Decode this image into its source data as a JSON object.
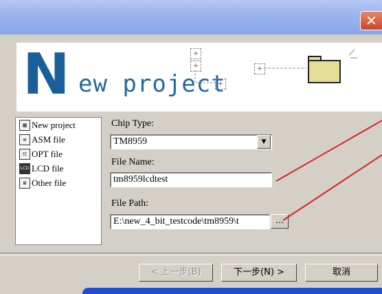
{
  "window": {
    "close_glyph": "✕"
  },
  "banner": {
    "big_letter": "N",
    "title_rest": "ew project",
    "deco_plus": "+"
  },
  "sidebar": {
    "items": [
      {
        "label": "New project",
        "icon": "new-project-icon"
      },
      {
        "label": "ASM file",
        "icon": "asm-file-icon"
      },
      {
        "label": "OPT file",
        "icon": "opt-file-icon"
      },
      {
        "label": "LCD file",
        "icon": "lcd-file-icon",
        "icon_text": "LCD"
      },
      {
        "label": "Other file",
        "icon": "other-file-icon"
      }
    ]
  },
  "form": {
    "chip_type_label": "Chip Type:",
    "chip_type_value": "TM8959",
    "file_name_label": "File Name:",
    "file_name_value": "tm8959lcdtest",
    "file_path_label": "File Path:",
    "file_path_value": "E:\\new_4_bit_testcode\\tm8959\\t",
    "browse_label": "..."
  },
  "buttons": {
    "back": "< 上一步(B)",
    "next": "下一步(N) >",
    "cancel": "取消"
  },
  "colors": {
    "accent": "#1a5f9a",
    "annotation_arrow": "#d9242a",
    "folder": "#e3dd98"
  }
}
